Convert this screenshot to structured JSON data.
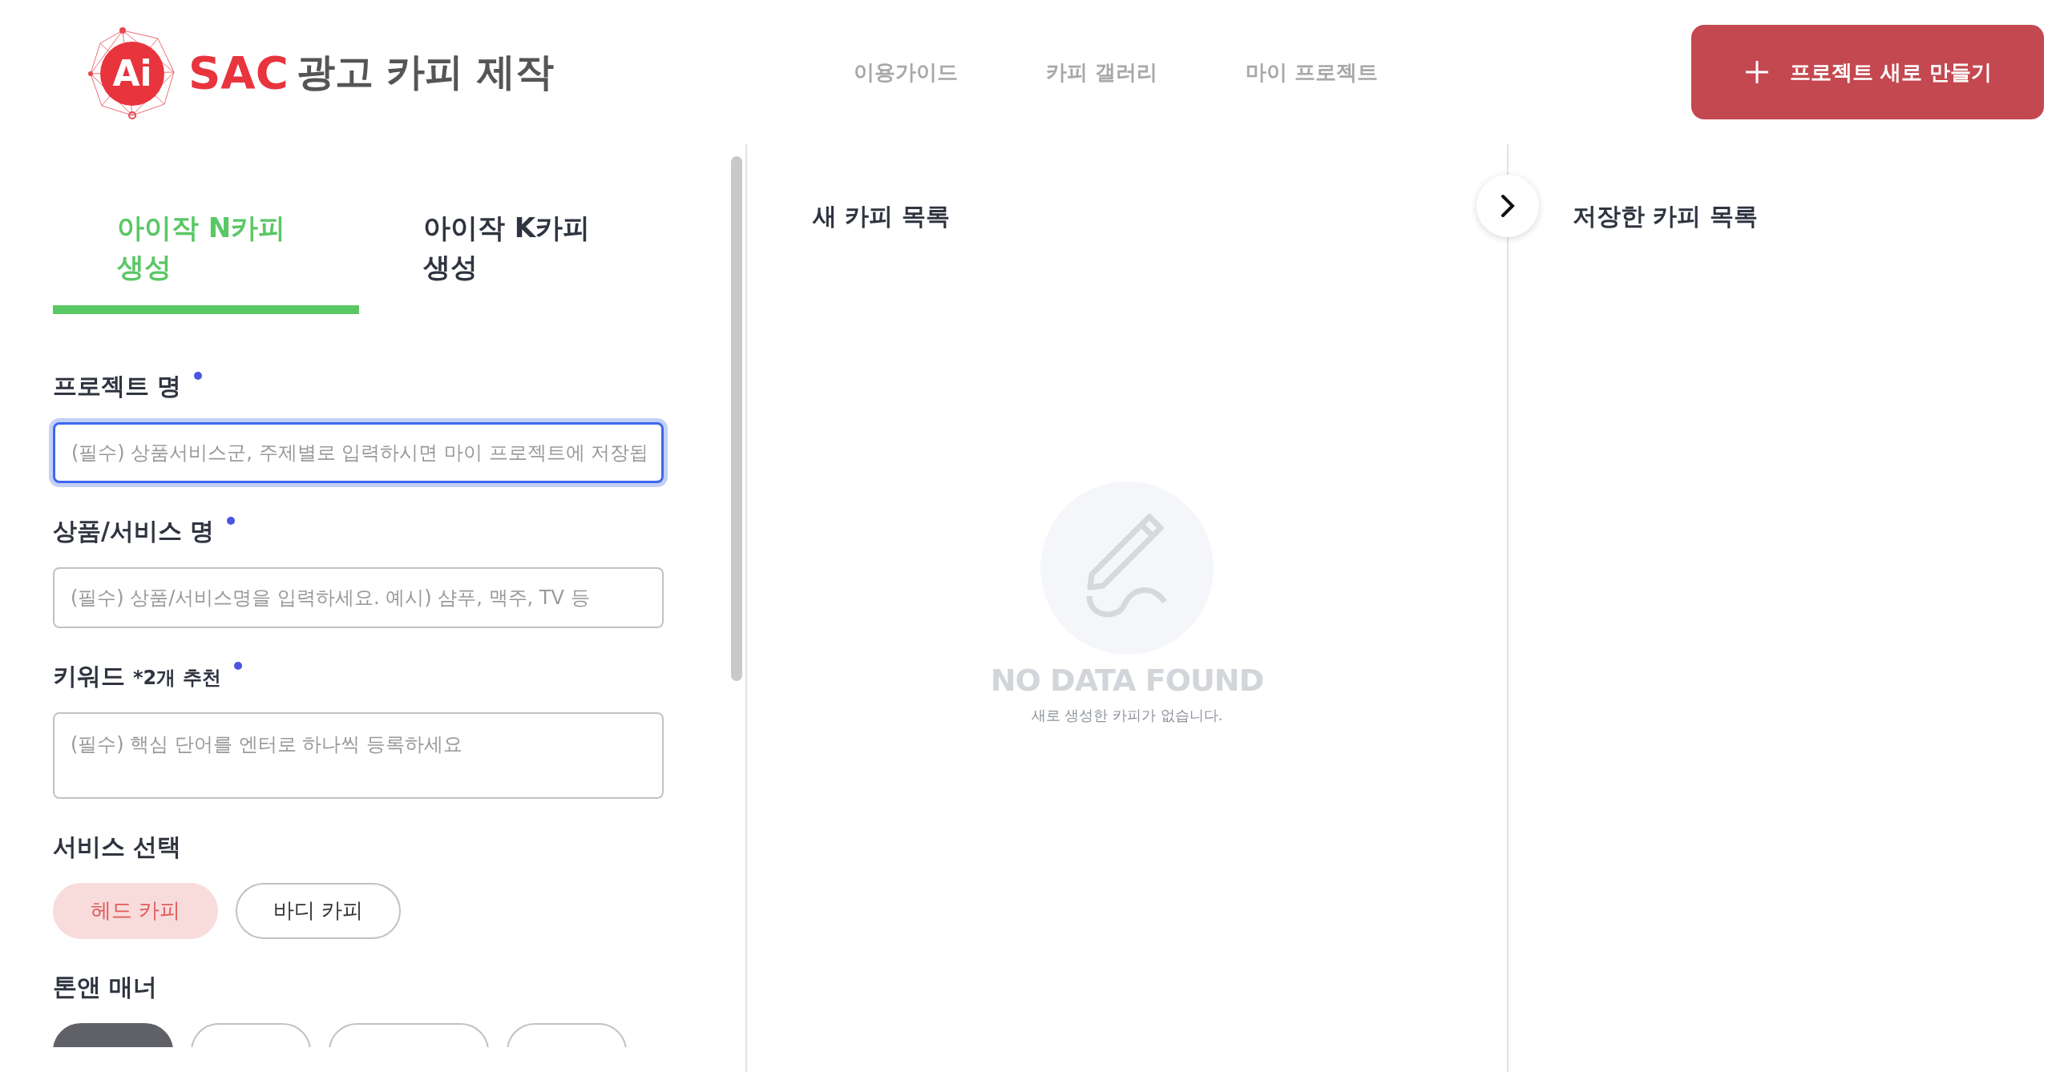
{
  "header": {
    "logo": {
      "badge": "Ai",
      "brand": "SAC",
      "title": "광고 카피 제작"
    },
    "nav": [
      {
        "label": "이용가이드"
      },
      {
        "label": "카피 갤러리"
      },
      {
        "label": "마이 프로젝트"
      }
    ],
    "new_project_button": {
      "label": "프로젝트 새로 만들기"
    }
  },
  "tabs": [
    {
      "label": "아이작 N카피 생성",
      "selected": true
    },
    {
      "label": "아이작 K카피 생성",
      "selected": false
    }
  ],
  "form": {
    "fields": [
      {
        "kind": "input",
        "label": "프로젝트 명",
        "required": true,
        "placeholder": "(필수) 상품서비스군, 주제별로 입력하시면 마이 프로젝트에 저장됩",
        "focused": true
      },
      {
        "kind": "input",
        "label": "상품/서비스 명",
        "required": true,
        "placeholder": "(필수) 상품/서비스명을 입력하세요. 예시) 샴푸, 맥주, TV 등",
        "focused": false
      },
      {
        "kind": "textarea",
        "label": "키워드",
        "hint": "*2개 추천",
        "required": true,
        "placeholder": "(필수) 핵심 단어를 엔터로 하나씩 등록하세요",
        "focused": false
      }
    ],
    "service": {
      "label": "서비스 선택",
      "options": [
        {
          "label": "헤드 카피",
          "selected": true
        },
        {
          "label": "바디 카피",
          "selected": false
        }
      ]
    },
    "tone": {
      "label": "톤앤 매너",
      "options": [
        {
          "selected": true
        },
        {
          "selected": false
        },
        {
          "selected": false
        },
        {
          "selected": false
        }
      ]
    }
  },
  "new_copies": {
    "title": "새 카피 목록",
    "empty": {
      "title": "NO DATA FOUND",
      "message": "새로 생성한 카피가 없습니다."
    }
  },
  "saved_copies": {
    "title": "저장한 카피 목록"
  }
}
